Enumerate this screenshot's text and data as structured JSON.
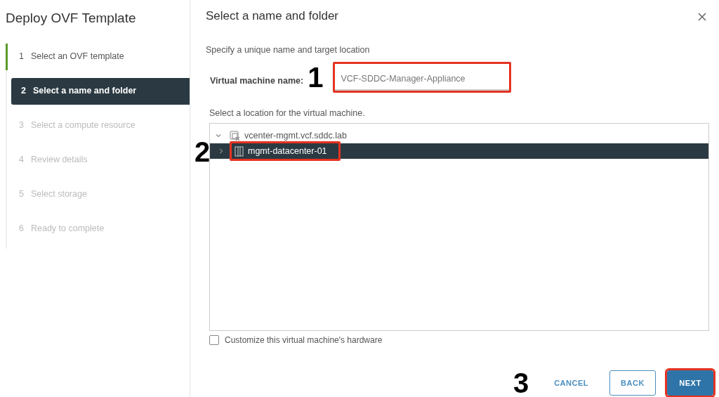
{
  "wizard": {
    "title": "Deploy OVF Template",
    "steps": [
      {
        "number": "1",
        "label": "Select an OVF template",
        "completed": true,
        "selected": false,
        "disabled": false
      },
      {
        "number": "2",
        "label": "Select a name and folder",
        "completed": false,
        "selected": true,
        "disabled": false
      },
      {
        "number": "3",
        "label": "Select a compute resource",
        "completed": false,
        "selected": false,
        "disabled": true
      },
      {
        "number": "4",
        "label": "Review details",
        "completed": false,
        "selected": false,
        "disabled": true
      },
      {
        "number": "5",
        "label": "Select storage",
        "completed": false,
        "selected": false,
        "disabled": true
      },
      {
        "number": "6",
        "label": "Ready to complete",
        "completed": false,
        "selected": false,
        "disabled": true
      }
    ]
  },
  "panel": {
    "title": "Select a name and folder",
    "subtitle": "Specify a unique name and target location",
    "vm_name": {
      "label": "Virtual machine name:",
      "value": "VCF-SDDC-Manager-Appliance",
      "callout": "1"
    },
    "location": {
      "label": "Select a location for the virtual machine.",
      "tree": [
        {
          "label": "vcenter-mgmt.vcf.sddc.lab",
          "kind": "vcenter",
          "expanded": true,
          "selected": false,
          "children": [
            {
              "label": "mgmt-datacenter-01",
              "kind": "datacenter",
              "expanded": false,
              "selected": true,
              "callout": "2"
            }
          ]
        }
      ]
    },
    "customize": {
      "label": "Customize this virtual machine's hardware",
      "checked": false
    },
    "callout": "3",
    "buttons": [
      {
        "label": "CANCEL",
        "kind": "link",
        "highlighted": false
      },
      {
        "label": "BACK",
        "kind": "outline",
        "highlighted": false
      },
      {
        "label": "NEXT",
        "kind": "primary",
        "highlighted": true
      }
    ]
  }
}
